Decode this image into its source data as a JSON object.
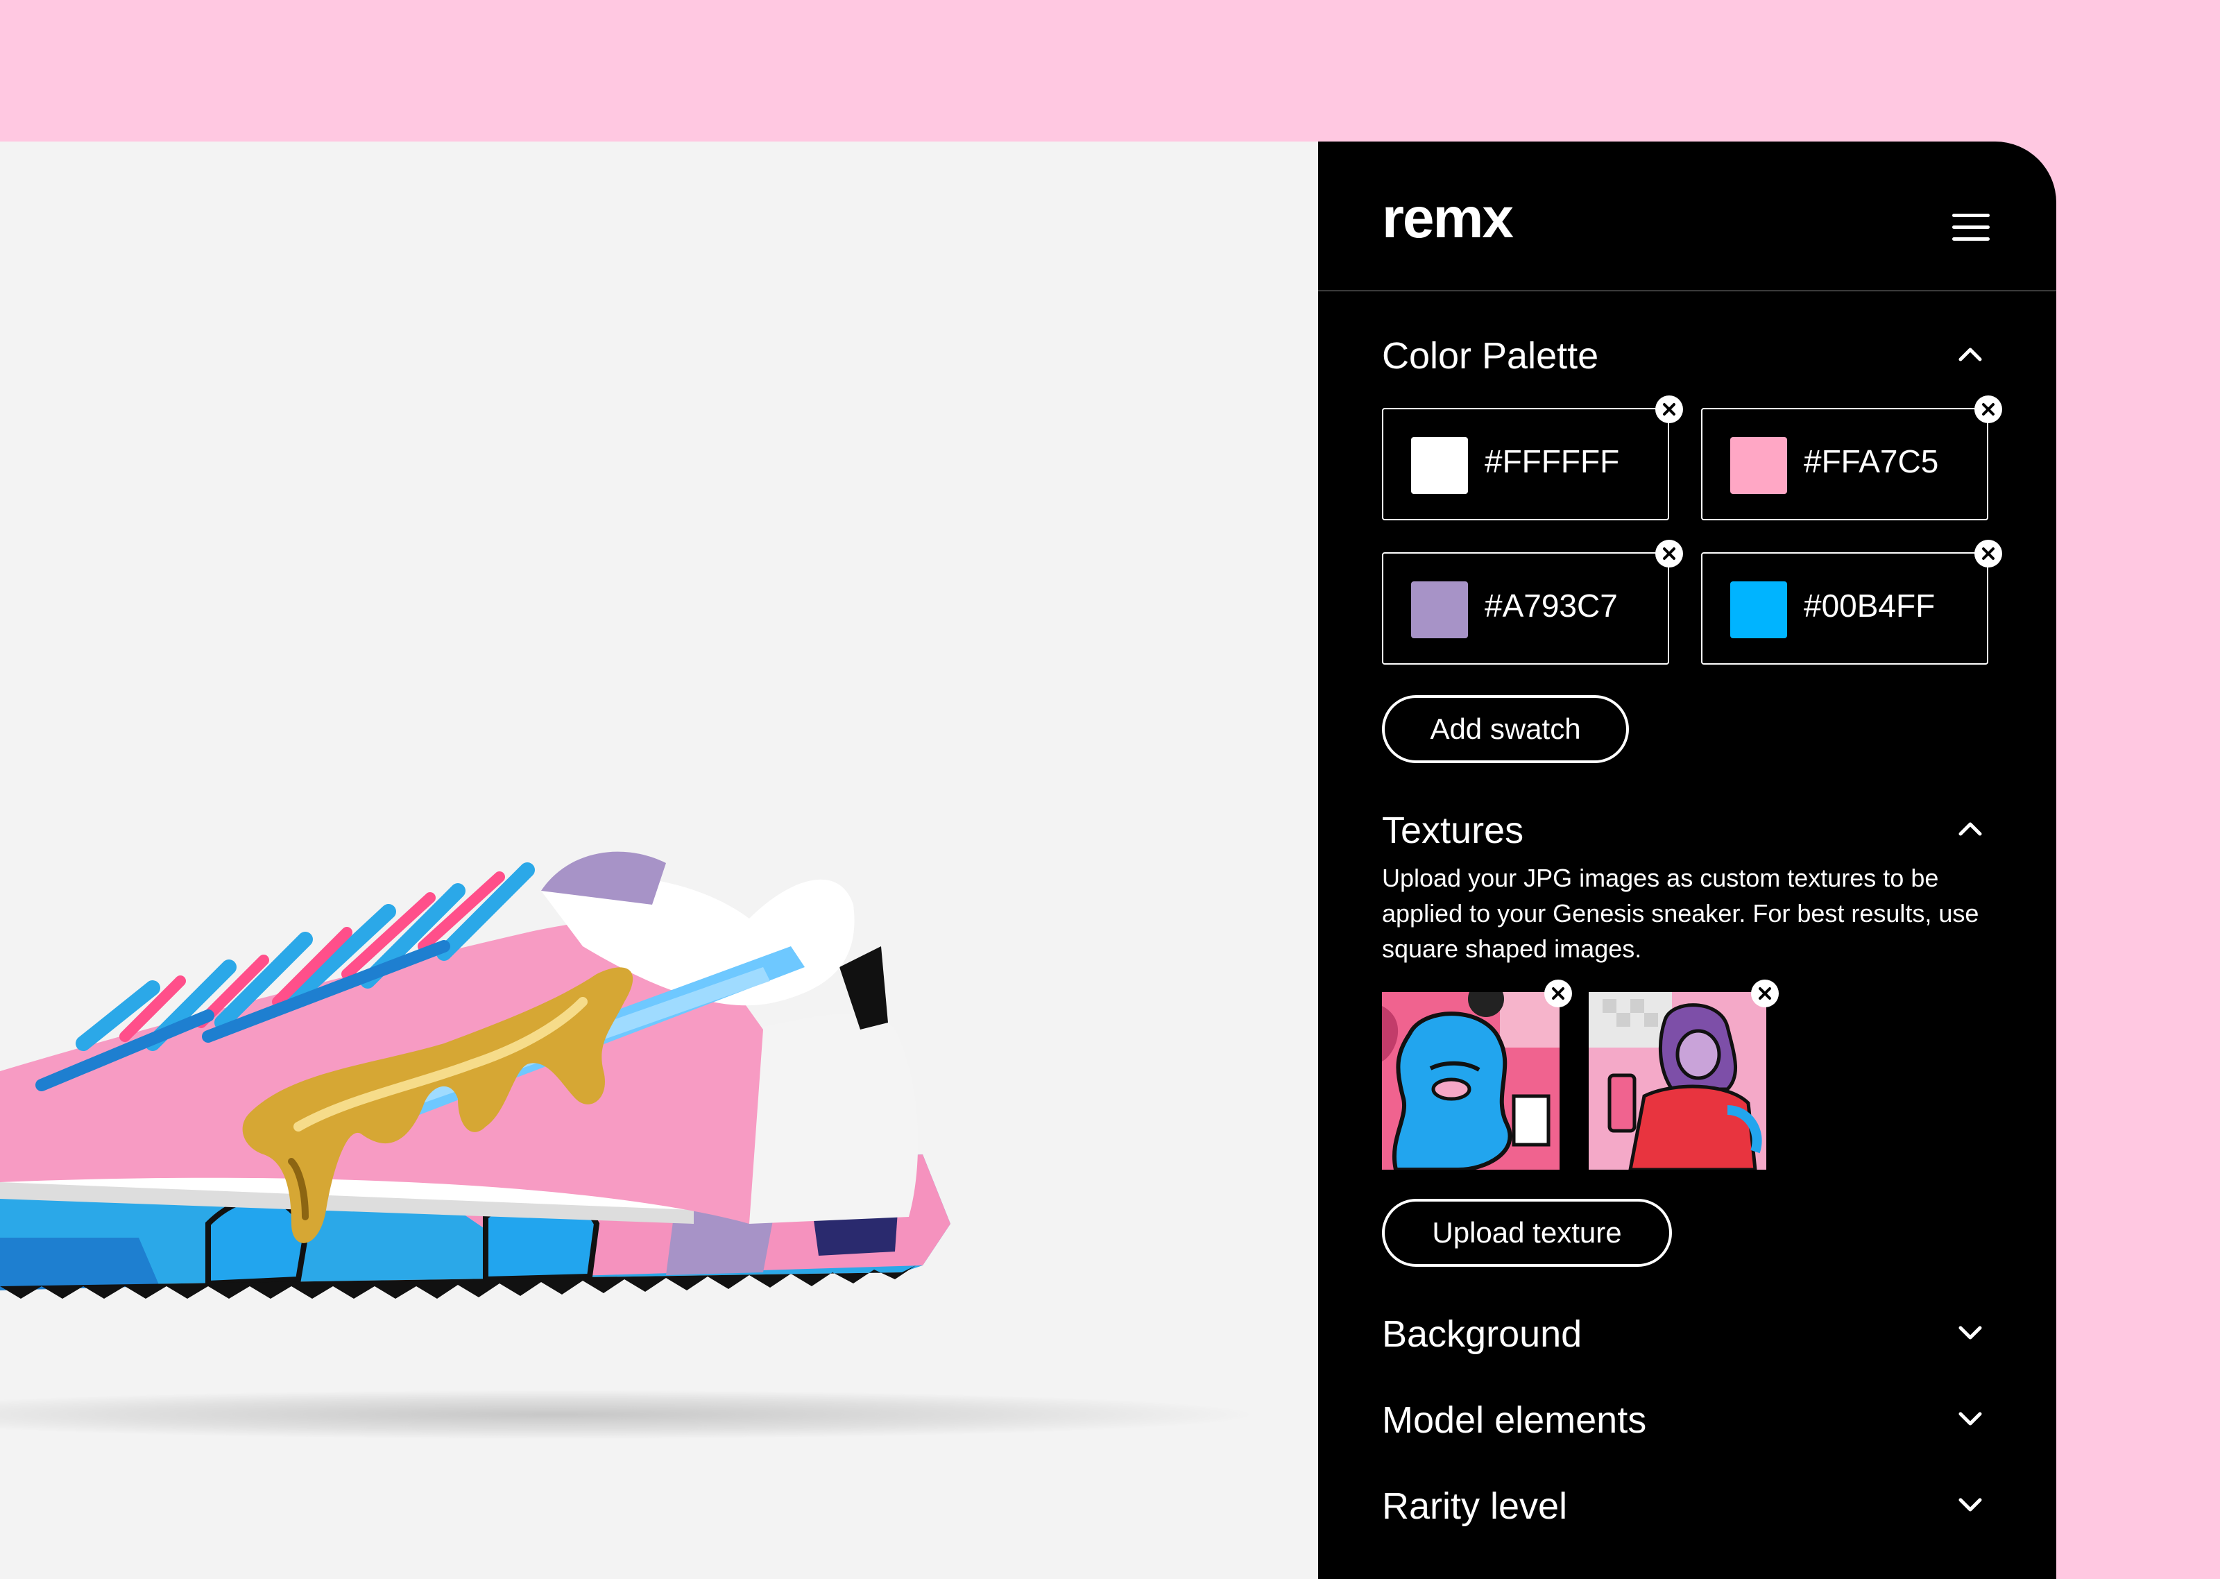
{
  "app": {
    "logo": "remx",
    "menu_icon": "hamburger-menu-icon"
  },
  "color_palette": {
    "title": "Color Palette",
    "expanded": true,
    "swatches": [
      {
        "hex": "#FFFFFF",
        "color": "#FFFFFF"
      },
      {
        "hex": "#FFA7C5",
        "color": "#FFA7C5"
      },
      {
        "hex": "#A793C7",
        "color": "#A793C7"
      },
      {
        "hex": "#00B4FF",
        "color": "#00B4FF"
      }
    ],
    "add_label": "Add swatch"
  },
  "textures": {
    "title": "Textures",
    "expanded": true,
    "description": "Upload your JPG images as custom textures to be applied to your Genesis sneaker. For best results, use square shaped images.",
    "thumbnails": [
      {
        "name": "blue-character-texture"
      },
      {
        "name": "pink-character-texture"
      }
    ],
    "upload_label": "Upload texture"
  },
  "collapsed_sections": [
    {
      "title": "Background",
      "expanded": false
    },
    {
      "title": "Model elements",
      "expanded": false
    },
    {
      "title": "Rarity level",
      "expanded": false
    }
  ],
  "colors": {
    "page_background": "#FFC8E1",
    "stage_background": "#F3F3F3",
    "panel_background": "#000000",
    "panel_text": "#FFFFFF"
  }
}
